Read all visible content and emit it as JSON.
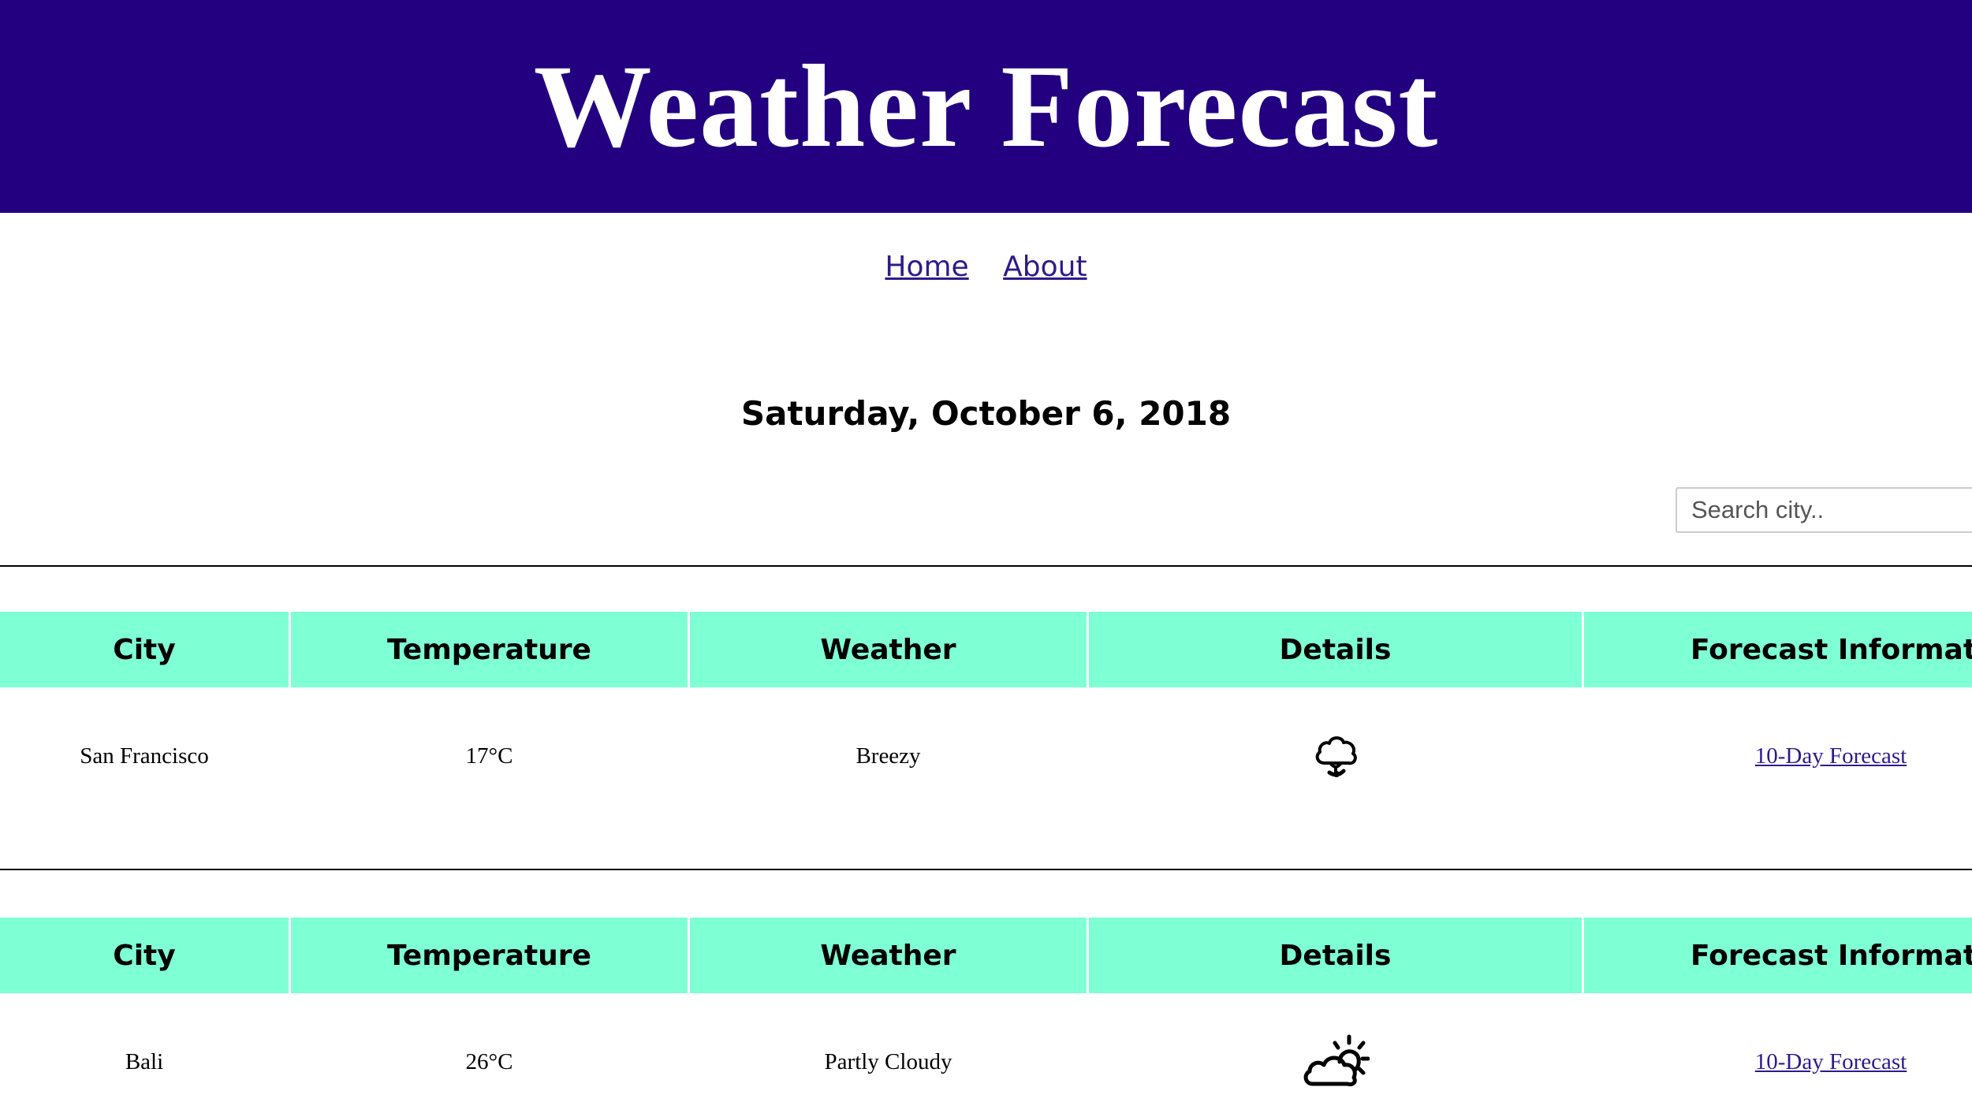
{
  "header": {
    "title": "Weather Forecast"
  },
  "nav": {
    "items": [
      {
        "label": "Home"
      },
      {
        "label": "About"
      }
    ]
  },
  "date": "Saturday, October 6, 2018",
  "search": {
    "placeholder": "Search city..",
    "value": ""
  },
  "table_headers": [
    "City",
    "Temperature",
    "Weather",
    "Details",
    "Forecast Information"
  ],
  "cities": [
    {
      "city": "San Francisco",
      "temperature": "17°C",
      "weather": "Breezy",
      "icon": "wind-cloud-icon",
      "link": "10-Day Forecast"
    },
    {
      "city": "Bali",
      "temperature": "26°C",
      "weather": "Partly Cloudy",
      "icon": "partly-cloudy-icon",
      "link": "10-Day Forecast"
    }
  ],
  "colors": {
    "header_bg": "#220080",
    "table_header_bg": "#7fffd4",
    "link": "#2e1b8a"
  }
}
